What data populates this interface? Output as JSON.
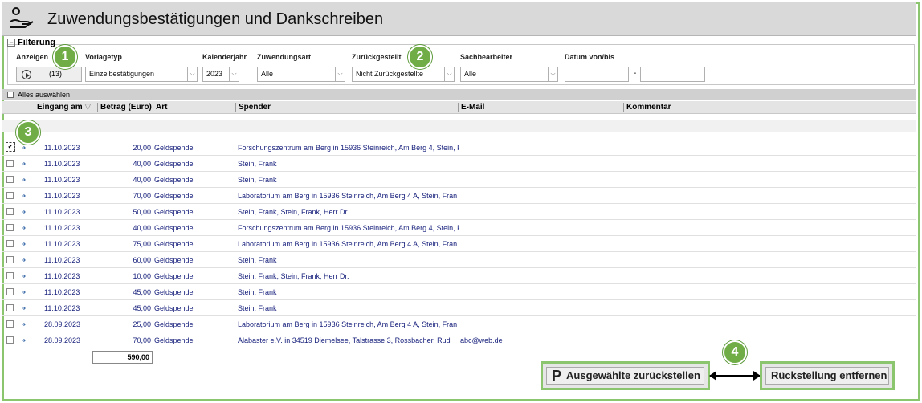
{
  "header": {
    "title": "Zuwendungsbestätigungen und Dankschreiben",
    "icon": "hand-with-person-icon"
  },
  "filter": {
    "legend": "Filterung",
    "labels": {
      "anzeigen": "Anzeigen",
      "vorlagetyp": "Vorlagetyp",
      "kalenderjahr": "Kalenderjahr",
      "zuwendungsart": "Zuwendungsart",
      "zurueckgestellt": "Zurückgestellt",
      "sachbearbeiter": "Sachbearbeiter",
      "datum": "Datum von/bis"
    },
    "show_count": "(13)",
    "values": {
      "vorlagetyp": "Einzelbestätigungen",
      "kalenderjahr": "2023",
      "zuwendungsart": "Alle",
      "zurueckgestellt": "Nicht Zurückgestellte",
      "sachbearbeiter": "Alle",
      "datum_von": "",
      "datum_bis": ""
    },
    "dash": "-"
  },
  "select_all": "Alles auswählen",
  "columns": {
    "eingang": "Eingang am",
    "betrag": "Betrag (Euro)",
    "art": "Art",
    "spender": "Spender",
    "email": "E-Mail",
    "kommentar": "Kommentar"
  },
  "rows": [
    {
      "checked": true,
      "date": "11.10.2023",
      "amount": "20,00",
      "art": "Geldspende",
      "spender": "Forschungszentrum am Berg in 15936 Steinreich, Am Berg 4, Stein, F",
      "email": ""
    },
    {
      "checked": false,
      "date": "11.10.2023",
      "amount": "40,00",
      "art": "Geldspende",
      "spender": "Stein, Frank",
      "email": ""
    },
    {
      "checked": false,
      "date": "11.10.2023",
      "amount": "40,00",
      "art": "Geldspende",
      "spender": "Stein, Frank",
      "email": ""
    },
    {
      "checked": false,
      "date": "11.10.2023",
      "amount": "70,00",
      "art": "Geldspende",
      "spender": "Laboratorium am Berg in 15936 Steinreich, Am Berg 4 A, Stein, Fran",
      "email": ""
    },
    {
      "checked": false,
      "date": "11.10.2023",
      "amount": "50,00",
      "art": "Geldspende",
      "spender": "Stein, Frank, Stein, Frank, Herr Dr.",
      "email": ""
    },
    {
      "checked": false,
      "date": "11.10.2023",
      "amount": "40,00",
      "art": "Geldspende",
      "spender": "Forschungszentrum am Berg in 15936 Steinreich, Am Berg 4, Stein, F",
      "email": ""
    },
    {
      "checked": false,
      "date": "11.10.2023",
      "amount": "75,00",
      "art": "Geldspende",
      "spender": "Laboratorium am Berg in 15936 Steinreich, Am Berg 4 A, Stein, Fran",
      "email": ""
    },
    {
      "checked": false,
      "date": "11.10.2023",
      "amount": "60,00",
      "art": "Geldspende",
      "spender": "Stein, Frank",
      "email": ""
    },
    {
      "checked": false,
      "date": "11.10.2023",
      "amount": "10,00",
      "art": "Geldspende",
      "spender": "Stein, Frank, Stein, Frank, Herr Dr.",
      "email": ""
    },
    {
      "checked": false,
      "date": "11.10.2023",
      "amount": "45,00",
      "art": "Geldspende",
      "spender": "Stein, Frank",
      "email": ""
    },
    {
      "checked": false,
      "date": "11.10.2023",
      "amount": "45,00",
      "art": "Geldspende",
      "spender": "Stein, Frank",
      "email": ""
    },
    {
      "checked": false,
      "date": "28.09.2023",
      "amount": "25,00",
      "art": "Geldspende",
      "spender": "Laboratorium am Berg in 15936 Steinreich, Am Berg 4 A, Stein, Fran",
      "email": ""
    },
    {
      "checked": false,
      "date": "28.09.2023",
      "amount": "70,00",
      "art": "Geldspende",
      "spender": "Alabaster e.V. in 34519 Diemelsee, Talstrasse 3, Rossbacher, Rud",
      "email": "abc@web.de"
    }
  ],
  "sum": "590,00",
  "buttons": {
    "zurueckstellen": "Ausgewählte zurückstellen",
    "zurueckstellen_icon": "P",
    "entfernen": "Rückstellung entfernen"
  },
  "badges": [
    "1",
    "2",
    "3",
    "4"
  ],
  "colors": {
    "accent_green": "#70ad47",
    "frame_green": "#8bc56e",
    "header_gray": "#d9d9d9"
  }
}
